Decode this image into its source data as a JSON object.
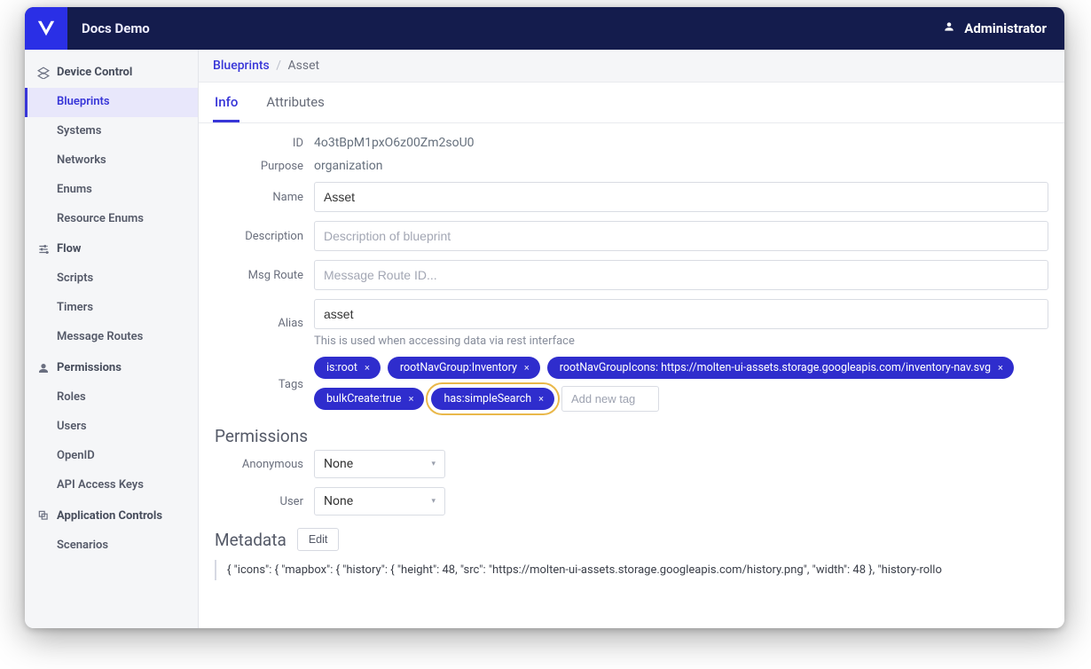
{
  "header": {
    "app_title": "Docs Demo",
    "user_name": "Administrator"
  },
  "sidebar": {
    "groups": [
      {
        "label": "Device Control",
        "items": [
          "Blueprints",
          "Systems",
          "Networks",
          "Enums",
          "Resource Enums"
        ],
        "active_index": 0
      },
      {
        "label": "Flow",
        "items": [
          "Scripts",
          "Timers",
          "Message Routes"
        ]
      },
      {
        "label": "Permissions",
        "items": [
          "Roles",
          "Users",
          "OpenID",
          "API Access Keys"
        ]
      },
      {
        "label": "Application Controls",
        "items": [
          "Scenarios"
        ]
      }
    ]
  },
  "breadcrumbs": {
    "root": "Blueprints",
    "current": "Asset"
  },
  "tabs": [
    {
      "label": "Info",
      "active": true
    },
    {
      "label": "Attributes",
      "active": false
    }
  ],
  "form": {
    "id_label": "ID",
    "id_value": "4o3tBpM1pxO6z00Zm2soU0",
    "purpose_label": "Purpose",
    "purpose_value": "organization",
    "name_label": "Name",
    "name_value": "Asset",
    "description_label": "Description",
    "description_value": "",
    "description_placeholder": "Description of blueprint",
    "msgroute_label": "Msg Route",
    "msgroute_value": "",
    "msgroute_placeholder": "Message Route ID...",
    "alias_label": "Alias",
    "alias_value": "asset",
    "alias_hint": "This is used when accessing data via rest interface",
    "tags_label": "Tags",
    "tags": [
      "is:root",
      "rootNavGroup:Inventory",
      "rootNavGroupIcons: https://molten-ui-assets.storage.googleapis.com/inventory-nav.svg",
      "bulkCreate:true",
      "has:simpleSearch"
    ],
    "highlight_tag_index": 4,
    "add_tag_placeholder": "Add new tag"
  },
  "permissions": {
    "title": "Permissions",
    "anonymous_label": "Anonymous",
    "anonymous_value": "None",
    "user_label": "User",
    "user_value": "None"
  },
  "metadata": {
    "title": "Metadata",
    "edit_label": "Edit",
    "json_preview": "{ \"icons\": { \"mapbox\": { \"history\": { \"height\": 48, \"src\": \"https://molten-ui-assets.storage.googleapis.com/history.png\", \"width\": 48 }, \"history-rollo"
  }
}
